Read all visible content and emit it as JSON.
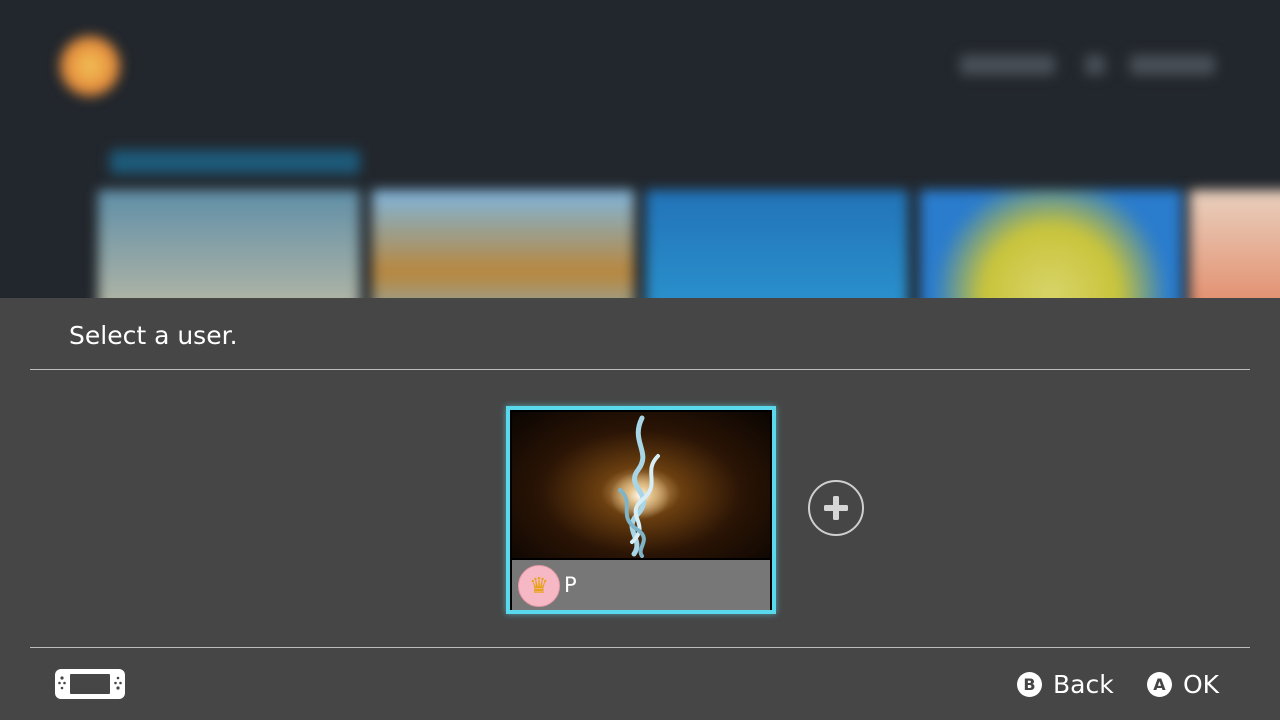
{
  "dialog": {
    "title": "Select a user."
  },
  "users": [
    {
      "name": "P",
      "avatar_icon": "crown-icon"
    }
  ],
  "add_user": {
    "icon": "plus-icon"
  },
  "footer": {
    "console_icon": "handheld-console-icon",
    "back": {
      "button": "B",
      "label": "Back"
    },
    "ok": {
      "button": "A",
      "label": "OK"
    }
  },
  "colors": {
    "panel_bg": "#464646",
    "selection_border": "#5ad8ec",
    "namebar_bg": "#777777"
  }
}
